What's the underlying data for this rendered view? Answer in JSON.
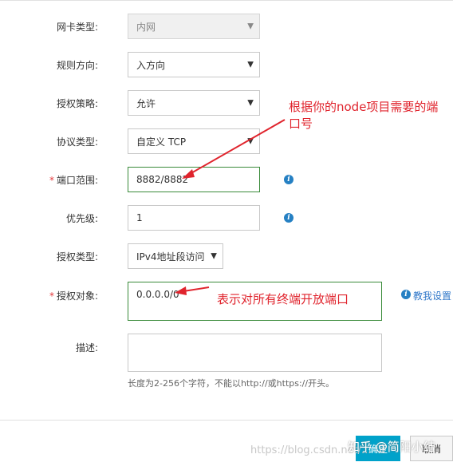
{
  "form": {
    "nic_type": {
      "label": "网卡类型:",
      "value": "内网"
    },
    "rule_direction": {
      "label": "规则方向:",
      "value": "入方向"
    },
    "auth_policy": {
      "label": "授权策略:",
      "value": "允许"
    },
    "protocol_type": {
      "label": "协议类型:",
      "value": "自定义 TCP"
    },
    "port_range": {
      "required_mark": "*",
      "label": "端口范围:",
      "value": "8882/8882"
    },
    "priority": {
      "label": "优先级:",
      "value": "1"
    },
    "auth_type": {
      "label": "授权类型:",
      "value": "IPv4地址段访问"
    },
    "auth_object": {
      "required_mark": "*",
      "label": "授权对象:",
      "value": "0.0.0.0/0",
      "help_link": "教我设置"
    },
    "description": {
      "label": "描述:",
      "value": "",
      "hint": "长度为2-256个字符，不能以http://或https://开头。"
    }
  },
  "annotations": {
    "port_note_line1": "根据你的node项目需要的端",
    "port_note_line2": "口号",
    "object_note": "表示对所有终端开放端口"
  },
  "footer": {
    "confirm_label": "确定",
    "cancel_label": "取消"
  },
  "watermark": {
    "text": "知乎 @简阳小结",
    "url": "https://blog.csdn.net/..."
  },
  "colors": {
    "accent_blue": "#00a2ca",
    "info_icon": "#2580c3",
    "annotation_red": "#e0242d",
    "valid_border": "#3a8b3a",
    "required_mark": "#e4393c"
  },
  "icons": {
    "info": "info-circle-icon",
    "dropdown": "caret-down-icon"
  }
}
